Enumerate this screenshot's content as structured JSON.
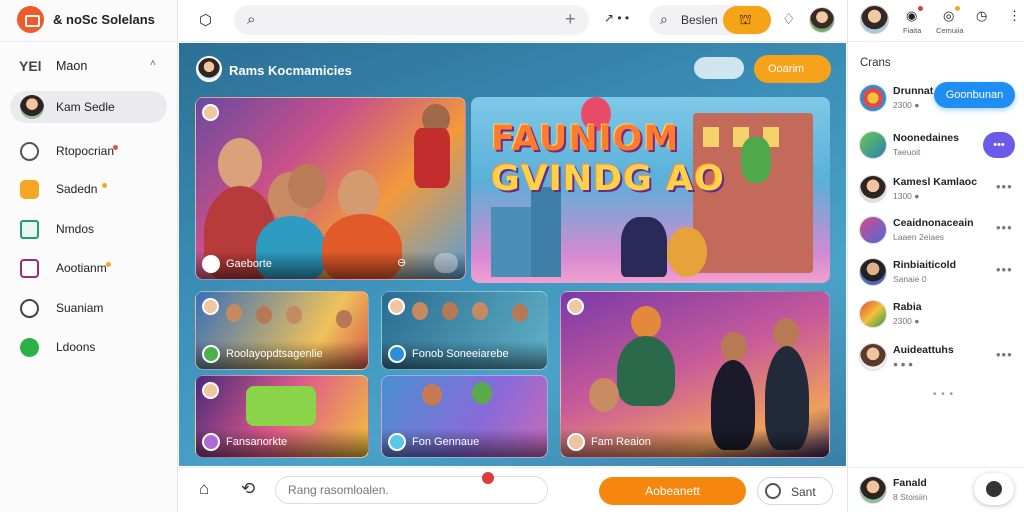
{
  "brand": {
    "name": "& noSc Solelans"
  },
  "sidebar": {
    "header": {
      "icon": "YEl",
      "label": "Maon",
      "caret": "˄"
    },
    "items": [
      {
        "label": "Kam Sedle",
        "icon": "user-avatar",
        "active": true
      },
      {
        "label": "Rtopocrian",
        "icon": "podcast-icon",
        "dot_color": "#e0543b"
      },
      {
        "label": "Sadedn",
        "icon": "folder-icon",
        "dot_color": "#f2a91e"
      },
      {
        "label": "Nmdos",
        "icon": "trending-icon"
      },
      {
        "label": "Aootianm",
        "icon": "tv-icon",
        "dot_color": "#f2a91e"
      },
      {
        "label": "Suaniam",
        "icon": "search-icon"
      },
      {
        "label": "Ldoons",
        "icon": "game-icon"
      }
    ]
  },
  "topbar": {
    "search_placeholder": "",
    "search_pill_label": "Beslen",
    "icons": [
      "home-hex-icon",
      "search-icon",
      "plus-icon",
      "share-dots-icon",
      "gift-icon",
      "spark-icon"
    ]
  },
  "main": {
    "title": "Rams Kocmamicies",
    "create_label": "Ooarim",
    "hero_line1": "FAUNIOM",
    "hero_line2": "GVINDG AO",
    "cards": [
      {
        "label": "Gaeborte"
      },
      {
        "label": "Roolayopdtsagenlie"
      },
      {
        "label": "Fonob Soneeiarebe"
      },
      {
        "label": "Fansanorkte"
      },
      {
        "label": "Fon Gennaue"
      },
      {
        "label": "Fam Reaion"
      }
    ]
  },
  "composer": {
    "input_placeholder": "Rang rasomloalen.",
    "action_label": "Aobeanett",
    "send_label": "Sant"
  },
  "rpanel": {
    "top_labels": [
      "Fiaita",
      "Cemuiia"
    ],
    "section_title": "Crans",
    "primary_button": "Goonbunan",
    "items": [
      {
        "name": "Drunnat",
        "sub": "2300 ●"
      },
      {
        "name": "Noonedaines",
        "sub": "Taeuoit"
      },
      {
        "name": "Kamesl Kamlaoc",
        "sub": "1300 ●"
      },
      {
        "name": "Ceaidnonaceain",
        "sub": "Laaen 2eiaes"
      },
      {
        "name": "Rinbiaiticold",
        "sub": "Sanaie 0"
      },
      {
        "name": "Rabia",
        "sub": "2300 ●"
      },
      {
        "name": "Auideattuhs",
        "sub": "● ● ●"
      }
    ],
    "footer_name": "Fanald",
    "footer_sub": "8 Stoisiin"
  }
}
